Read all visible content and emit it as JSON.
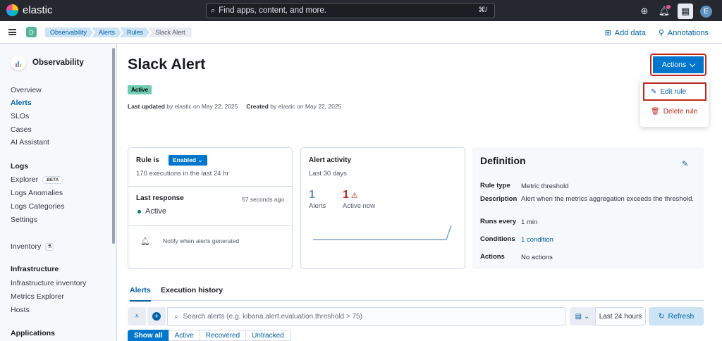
{
  "topbar": {
    "brand": "elastic",
    "search_placeholder": "Find apps, content, and more.",
    "search_shortcut": "⌘/",
    "avatar_letter": "E"
  },
  "subbar": {
    "space_letter": "D",
    "breadcrumbs": [
      "Observability",
      "Alerts",
      "Rules",
      "Slack Alert"
    ],
    "add_data": "Add data",
    "annotations": "Annotations"
  },
  "sidebar": {
    "title": "Observability",
    "items": [
      "Overview",
      "Alerts",
      "SLOs",
      "Cases",
      "AI Assistant"
    ],
    "logs_heading": "Logs",
    "logs_items": [
      "Explorer",
      "Logs Anomalies",
      "Logs Categories",
      "Settings"
    ],
    "beta": "BETA",
    "inventory": "Inventory",
    "infra_heading": "Infrastructure",
    "infra_items": [
      "Infrastructure inventory",
      "Metrics Explorer",
      "Hosts"
    ],
    "apps_heading": "Applications"
  },
  "page": {
    "title": "Slack Alert",
    "status": "Active",
    "last_updated_label": "Last updated",
    "last_updated_text": " by elastic on May 22, 2025",
    "created_label": "Created",
    "created_text": " by elastic on May 22, 2025"
  },
  "actions": {
    "label": "Actions",
    "edit": "Edit rule",
    "delete": "Delete rule"
  },
  "rule_card": {
    "rule_is": "Rule is",
    "enabled": "Enabled",
    "executions": "170 executions in the last 24 hr",
    "last_response": "Last response",
    "seconds_ago": "57 seconds ago",
    "response_status": "Active",
    "notify": "Notify when alerts generated"
  },
  "alert_activity": {
    "title": "Alert activity",
    "period": "Last 30 days",
    "alerts_count": "1",
    "alerts_label": "Alerts",
    "active_count": "1",
    "active_label": "Active now",
    "sparkline": [
      0,
      0,
      0,
      0,
      0,
      0,
      0,
      0,
      0,
      0,
      0,
      0,
      0,
      0,
      0,
      0,
      0,
      0,
      0,
      0,
      0,
      0,
      0,
      0,
      0,
      0,
      0,
      0,
      1
    ]
  },
  "definition": {
    "title": "Definition",
    "rows": [
      {
        "key": "Rule type",
        "value": "Metric threshold"
      },
      {
        "key": "Description",
        "value": "Alert when the metrics aggregation exceeds the threshold."
      },
      {
        "key": "Runs every",
        "value": "1 min"
      },
      {
        "key": "Conditions",
        "value": "1 condition"
      },
      {
        "key": "Actions",
        "value": "No actions"
      }
    ]
  },
  "tabs": [
    "Alerts",
    "Execution history"
  ],
  "alerts_filter": {
    "search_placeholder": "Search alerts (e.g. kibana.alert.evaluation.threshold > 75)",
    "date_range": "Last 24 hours",
    "refresh": "Refresh",
    "segments": [
      "Show all",
      "Active",
      "Recovered",
      "Untracked"
    ]
  },
  "colors": {
    "topbar": "#25282f",
    "primary": "#0077cc",
    "danger": "#bd271e",
    "success": "#6dccb1"
  }
}
